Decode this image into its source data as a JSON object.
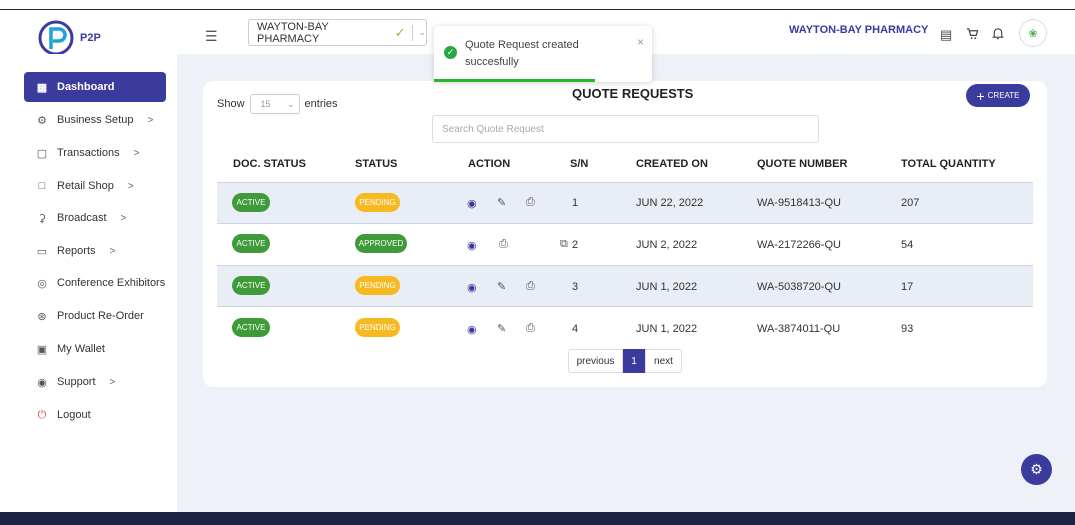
{
  "header": {
    "logo_text": "P2P",
    "store_select": "WAYTON-BAY PHARMACY",
    "store_name": "WAYTON-BAY PHARMACY",
    "icons": [
      "menu-icon",
      "receipt-icon",
      "cart-icon",
      "bell-icon",
      "avatar"
    ]
  },
  "sidebar": {
    "items": [
      {
        "label": "Dashboard",
        "icon": "grid-icon",
        "chevron": false,
        "active": true
      },
      {
        "label": "Business Setup",
        "icon": "gear-icon",
        "chevron": true
      },
      {
        "label": "Transactions",
        "icon": "document-icon",
        "chevron": true
      },
      {
        "label": "Retail Shop",
        "icon": "shop-icon",
        "chevron": true
      },
      {
        "label": "Broadcast",
        "icon": "mic-icon",
        "chevron": true
      },
      {
        "label": "Reports",
        "icon": "folder-icon",
        "chevron": true
      },
      {
        "label": "Conference Exhibitors",
        "icon": "target-icon",
        "chevron": false
      },
      {
        "label": "Product Re-Order",
        "icon": "cart-icon",
        "chevron": false
      },
      {
        "label": "My Wallet",
        "icon": "wallet-icon",
        "chevron": false
      },
      {
        "label": "Support",
        "icon": "support-icon",
        "chevron": true
      },
      {
        "label": "Logout",
        "icon": "power-icon",
        "chevron": false
      }
    ]
  },
  "main": {
    "title": "QUOTE REQUESTS",
    "create_label": "CREATE",
    "show_label": "Show",
    "page_length": "15",
    "entries_label": "entries",
    "search_placeholder": "Search Quote Request",
    "columns": [
      "DOC. STATUS",
      "STATUS",
      "ACTION",
      "S/N",
      "CREATED ON",
      "QUOTE NUMBER",
      "TOTAL QUANTITY"
    ],
    "rows": [
      {
        "doc_status": "ACTIVE",
        "status": "PENDING",
        "status_color": "#f7b922",
        "actions": [
          "eye-icon",
          "pencil-icon",
          "print-icon"
        ],
        "sn": "1",
        "created_on": "JUN 22, 2022",
        "quote_number": "WA-9518413-QU",
        "total_quantity": "207"
      },
      {
        "doc_status": "ACTIVE",
        "status": "APPROVED",
        "status_color": "#3f9a3a",
        "actions": [
          "eye-icon",
          "print-icon",
          "copy-icon"
        ],
        "sn": "2",
        "created_on": "JUN 2, 2022",
        "quote_number": "WA-2172266-QU",
        "total_quantity": "54"
      },
      {
        "doc_status": "ACTIVE",
        "status": "PENDING",
        "status_color": "#f7b922",
        "actions": [
          "eye-icon",
          "pencil-icon",
          "print-icon"
        ],
        "sn": "3",
        "created_on": "JUN 1, 2022",
        "quote_number": "WA-5038720-QU",
        "total_quantity": "17"
      },
      {
        "doc_status": "ACTIVE",
        "status": "PENDING",
        "status_color": "#f7b922",
        "actions": [
          "eye-icon",
          "pencil-icon",
          "print-icon"
        ],
        "sn": "4",
        "created_on": "JUN 1, 2022",
        "quote_number": "WA-3874011-QU",
        "total_quantity": "93"
      }
    ],
    "pagination": {
      "previous": "previous",
      "current": "1",
      "next": "next"
    }
  },
  "toast": {
    "message": "Quote Request created succesfully",
    "close": "×",
    "progress": 0.74
  },
  "colors": {
    "accent": "#3b3b9e",
    "active_green": "#3f9a3a",
    "pending_yellow": "#f7b922",
    "success_green": "#28a745"
  }
}
